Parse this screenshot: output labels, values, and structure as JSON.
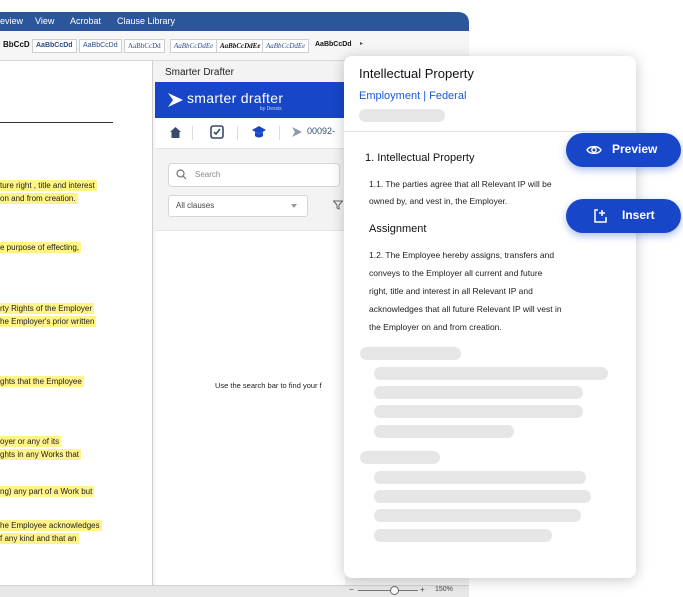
{
  "word": {
    "menu": [
      "eview",
      "View",
      "Acrobat",
      "Clause Library"
    ],
    "styles": [
      "BbCcD",
      "AaBbCcDd",
      "AaBbCcDd",
      "AaBbCcDd",
      "AaBbCcDdEe",
      "AaBbCcDdEe",
      "AaBbCcDdEe",
      "AaBbCcDdEe",
      "AaBbCcDd"
    ],
    "doc_highlights": [
      "ture right , title and interest",
      "on and from creation.",
      "e purpose of effecting,",
      "rty Rights of the Employer",
      "he Employer's prior written",
      "ghts that the Employee",
      "oyer or any of its",
      "ghts in any Works that",
      "ng) any part of a Work but",
      "he Employee acknowledges",
      "f any kind and that an"
    ],
    "zoom": {
      "minus": "−",
      "plus": "+",
      "value": "150%"
    }
  },
  "drafter": {
    "pane_title": "Smarter Drafter",
    "logo_text": "smarter drafter",
    "logo_sub": "by Dexsis",
    "breadcrumb_code": "00092-",
    "search_placeholder": "Search",
    "filter_value": "All clauses",
    "hint": "Use the search bar to find your f"
  },
  "card": {
    "title": "Intellectual Property",
    "subtitle": "Employment  | Federal",
    "heading1": "1. Intellectual Property",
    "para1": [
      "1.1. The parties agree that all Relevant IP will be",
      "owned by, and vest in, the Employer."
    ],
    "heading2": "Assignment",
    "para2": [
      "1.2. The Employee hereby assigns, transfers and",
      "conveys to the Employer all current and future",
      "right, title and interest in all Relevant IP and",
      "acknowledges that all future Relevant IP will vest in",
      "the Employer on and from creation."
    ]
  },
  "buttons": {
    "preview": "Preview",
    "insert": "Insert"
  },
  "colors": {
    "brand": "#1746c8",
    "highlight": "#fff38a",
    "word_blue": "#2b579a"
  }
}
